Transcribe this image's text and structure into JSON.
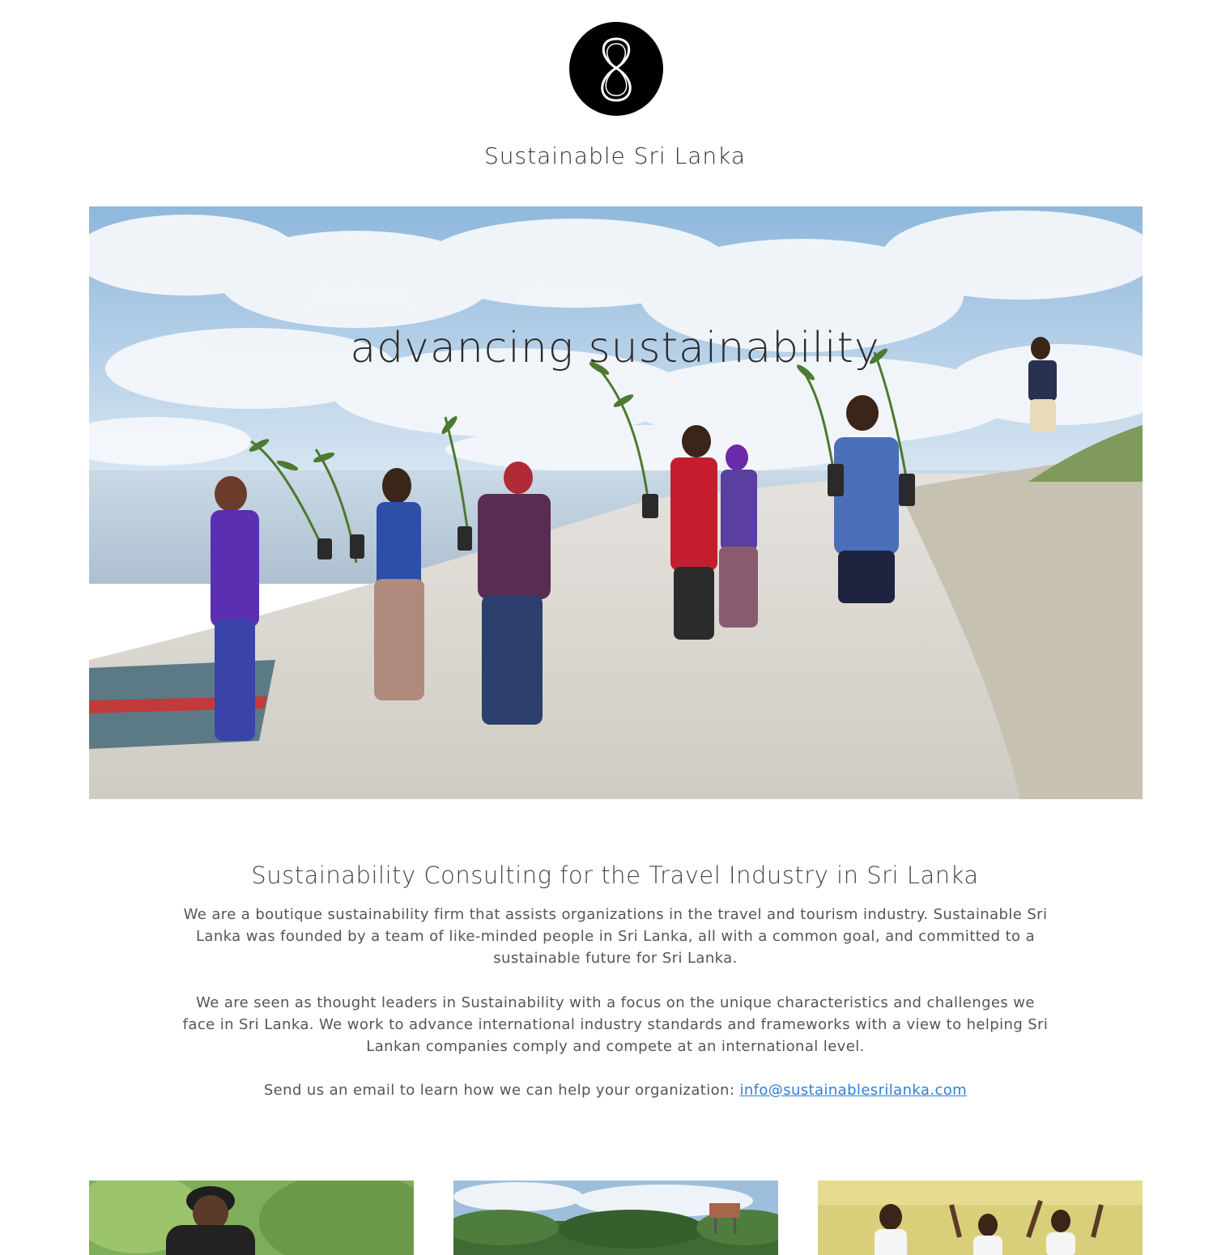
{
  "header": {
    "logo_icon": "infinity-eight-logo-icon",
    "site_title": "Sustainable Sri Lanka"
  },
  "hero": {
    "tagline": "advancing sustainability",
    "image": "people-planting-mangrove-saplings-on-beach"
  },
  "intro": {
    "heading": "Sustainability Consulting for the Travel Industry in Sri Lanka",
    "paragraph1": "We are a boutique sustainability firm that assists organizations in the travel and tourism industry. Sustainable Sri Lanka was founded by a team of like-minded people in Sri Lanka, all with a common goal, and committed to a sustainable future for Sri Lanka.",
    "paragraph2": "We are seen as thought leaders in Sustainability with a focus on the unique characteristics and challenges we face in Sri Lanka. We work to advance international industry standards and frameworks with a view to helping Sri Lankan companies comply and compete at an international level.",
    "cta_text": "Send us an email to learn how we can help your organization: ",
    "email": "info@sustainablesrilanka.com"
  },
  "gallery": [
    {
      "image": "man-in-cap-among-plants"
    },
    {
      "image": "watchtower-above-trees"
    },
    {
      "image": "students-raising-hands-in-classroom"
    }
  ],
  "colors": {
    "link": "#2f7fd6",
    "logo_bg": "#000000",
    "text": "#555555"
  }
}
